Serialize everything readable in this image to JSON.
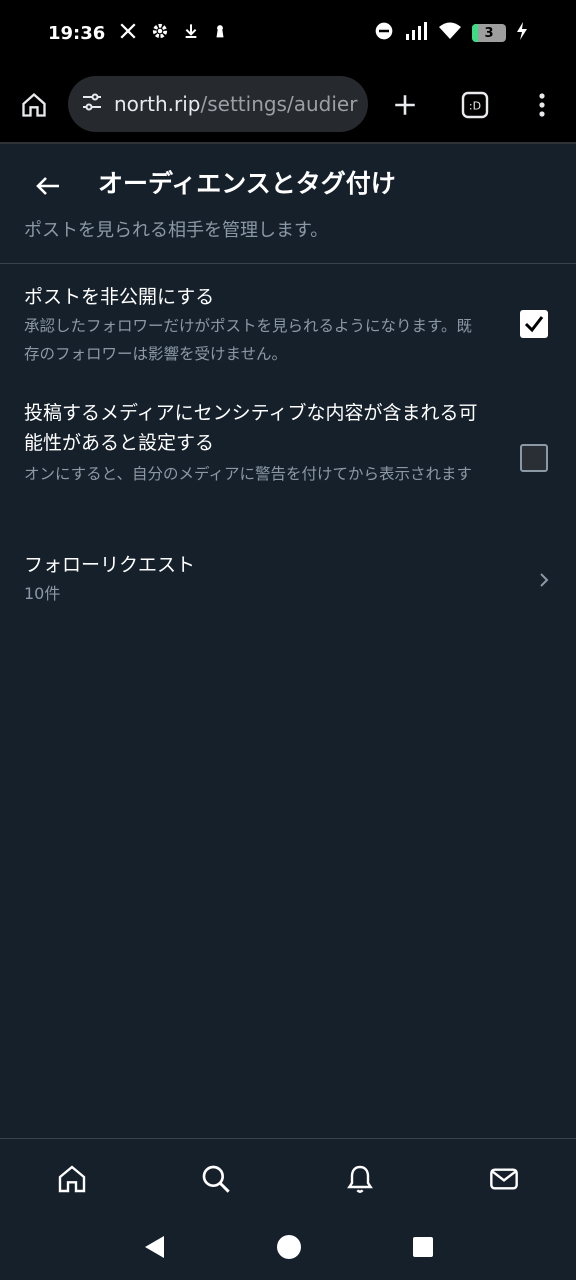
{
  "status_bar": {
    "time": "19:36",
    "battery_level": "3",
    "icons": [
      "x-logo-icon",
      "gear-icon",
      "download-icon",
      "keyhole-icon",
      "dnd-icon",
      "signal-icon",
      "wifi-icon",
      "battery-icon",
      "charging-icon"
    ]
  },
  "browser": {
    "url_host": "north.rip",
    "url_path": "/settings/audier",
    "icons": [
      "home-icon",
      "site-settings-icon",
      "new-tab-icon",
      "tab-switcher-icon",
      "more-menu-icon"
    ]
  },
  "header": {
    "title": "オーディエンスとタグ付け",
    "subtitle": "ポストを見られる相手を管理します。"
  },
  "settings": [
    {
      "label": "ポストを非公開にする",
      "description": "承認したフォロワーだけがポストを見られるようになります。既存のフォロワーは影響を受けません。",
      "checked": true
    },
    {
      "label": "投稿するメディアにセンシティブな内容が含まれる可能性があると設定する",
      "description": "オンにすると、自分のメディアに警告を付けてから表示されます",
      "checked": false
    }
  ],
  "follow_requests": {
    "label": "フォローリクエスト",
    "count": "10件"
  },
  "bottom_nav": [
    "home-icon",
    "search-icon",
    "bell-icon",
    "mail-icon"
  ],
  "colors": {
    "background": "#15202b",
    "secondary_text": "#8b98a5",
    "divider": "#38444d"
  }
}
